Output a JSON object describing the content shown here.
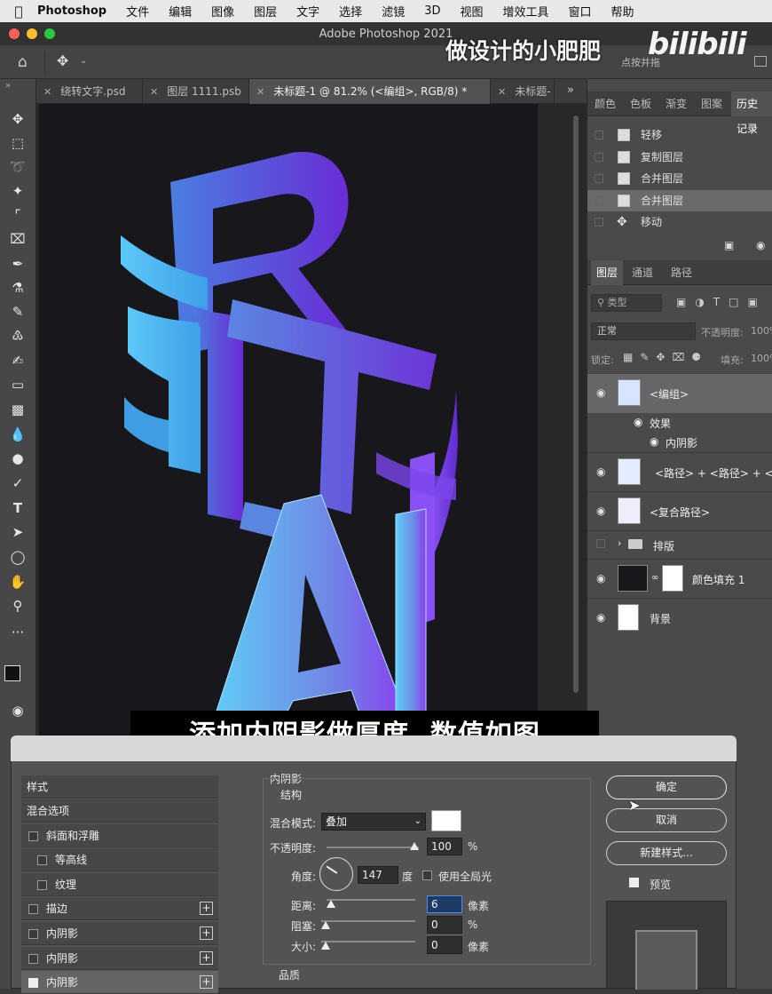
{
  "menubar": {
    "app": "Photoshop",
    "items": [
      "文件",
      "编辑",
      "图像",
      "图层",
      "文字",
      "选择",
      "滤镜",
      "3D",
      "视图",
      "增效工具",
      "窗口",
      "帮助"
    ]
  },
  "window": {
    "title": "Adobe Photoshop 2021",
    "watermark": "做设计的小肥肥",
    "watermark_logo": "bilibili",
    "options_hint": "点按并拖"
  },
  "tabs": [
    {
      "label": "绕转文字.psd"
    },
    {
      "label": "图层 1111.psb"
    },
    {
      "label": "未标题-1 @ 81.2% (<编组>, RGB/8) *"
    },
    {
      "label": "未标题-"
    }
  ],
  "top_panel": {
    "tabs": [
      "颜色",
      "色板",
      "渐变",
      "图案",
      "历史记录"
    ],
    "history": [
      {
        "label": "轻移"
      },
      {
        "label": "复制图层"
      },
      {
        "label": "合并图层"
      },
      {
        "label": "合并图层"
      },
      {
        "label": "移动"
      }
    ]
  },
  "layers_panel": {
    "tabs": [
      "图层",
      "通道",
      "路径"
    ],
    "filter_label": "类型",
    "blend_mode": "正常",
    "opacity_label": "不透明度:",
    "opacity_value": "100%",
    "lock_label": "锁定:",
    "fill_label": "填充:",
    "fill_value": "100%",
    "layers": [
      {
        "name": "<编组>",
        "effects_label": "效果",
        "effect": "内阴影"
      },
      {
        "name": "<路径> + <路径> + <路径"
      },
      {
        "name": "<复合路径>"
      },
      {
        "name": "排版"
      },
      {
        "name": "颜色填充 1"
      },
      {
        "name": "背景"
      }
    ]
  },
  "subtitle": "添加内阴影做厚度, 数值如图",
  "dialog": {
    "style_list": [
      {
        "label": "样式"
      },
      {
        "label": "混合选项"
      },
      {
        "label": "斜面和浮雕"
      },
      {
        "label": "等高线"
      },
      {
        "label": "纹理"
      },
      {
        "label": "描边"
      },
      {
        "label": "内阴影"
      },
      {
        "label": "内阴影"
      },
      {
        "label": "内阴影"
      }
    ],
    "section_title": "内阴影",
    "structure_title": "结构",
    "blend_mode_label": "混合模式:",
    "blend_mode_value": "叠加",
    "opacity_label": "不透明度:",
    "opacity_value": "100",
    "opacity_unit": "%",
    "angle_label": "角度:",
    "angle_value": "147",
    "angle_unit": "度",
    "global_light_label": "使用全局光",
    "distance_label": "距离:",
    "distance_value": "6",
    "distance_unit": "像素",
    "choke_label": "阻塞:",
    "choke_value": "0",
    "choke_unit": "%",
    "size_label": "大小:",
    "size_value": "0",
    "size_unit": "像素",
    "quality_title": "品质",
    "ok_label": "确定",
    "cancel_label": "取消",
    "new_style_label": "新建样式...",
    "preview_label": "预览"
  },
  "artwork": {
    "letters": [
      "R",
      "T",
      "AI"
    ],
    "colors": {
      "cyan": "#5cc8f7",
      "blue": "#4f6fdc",
      "purple": "#6a2bd6",
      "violet": "#8a3cf0"
    }
  }
}
